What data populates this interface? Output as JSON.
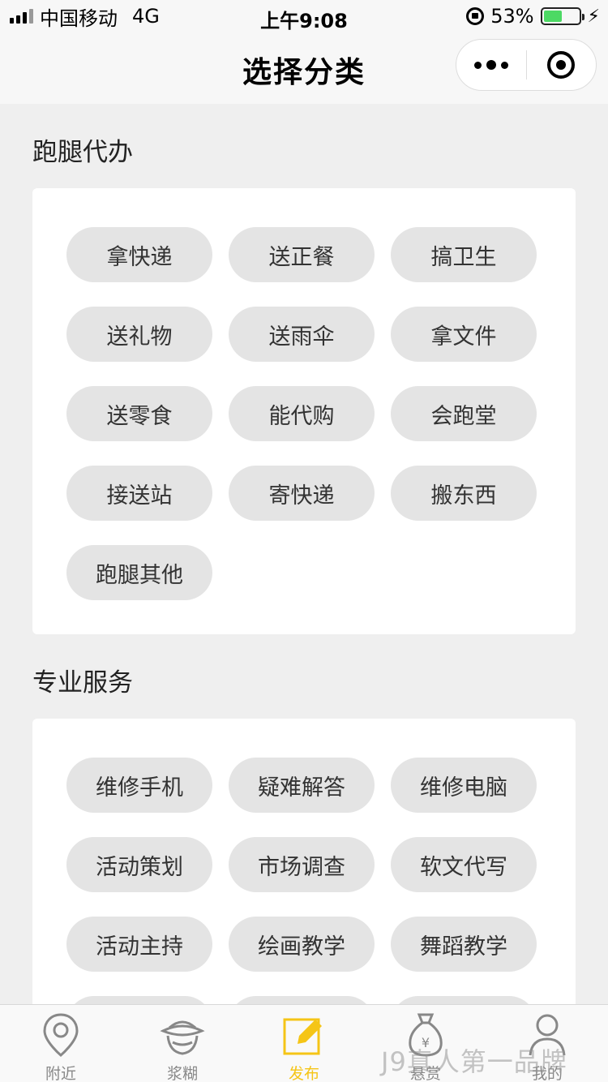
{
  "status_bar": {
    "carrier": "中国移动",
    "network": "4G",
    "time": "上午9:08",
    "battery_percent": "53%",
    "battery_level": 0.53
  },
  "nav": {
    "title": "选择分类"
  },
  "sections": [
    {
      "title": "跑腿代办",
      "items": [
        "拿快递",
        "送正餐",
        "搞卫生",
        "送礼物",
        "送雨伞",
        "拿文件",
        "送零食",
        "能代购",
        "会跑堂",
        "接送站",
        "寄快递",
        "搬东西",
        "跑腿其他"
      ]
    },
    {
      "title": "专业服务",
      "items": [
        "维修手机",
        "疑难解答",
        "维修电脑",
        "活动策划",
        "市场调查",
        "软文代写",
        "活动主持",
        "绘画教学",
        "舞蹈教学"
      ]
    }
  ],
  "tabs": [
    {
      "label": "附近",
      "icon": "location-pin-icon"
    },
    {
      "label": "浆糊",
      "icon": "paste-pot-icon"
    },
    {
      "label": "发布",
      "icon": "edit-icon",
      "active": true
    },
    {
      "label": "悬赏",
      "icon": "money-bag-icon"
    },
    {
      "label": "我的",
      "icon": "user-icon"
    }
  ],
  "watermark": "J9真人第一品牌",
  "colors": {
    "accent": "#f5c516",
    "chip_bg": "#e4e4e4",
    "page_bg": "#efefef"
  }
}
